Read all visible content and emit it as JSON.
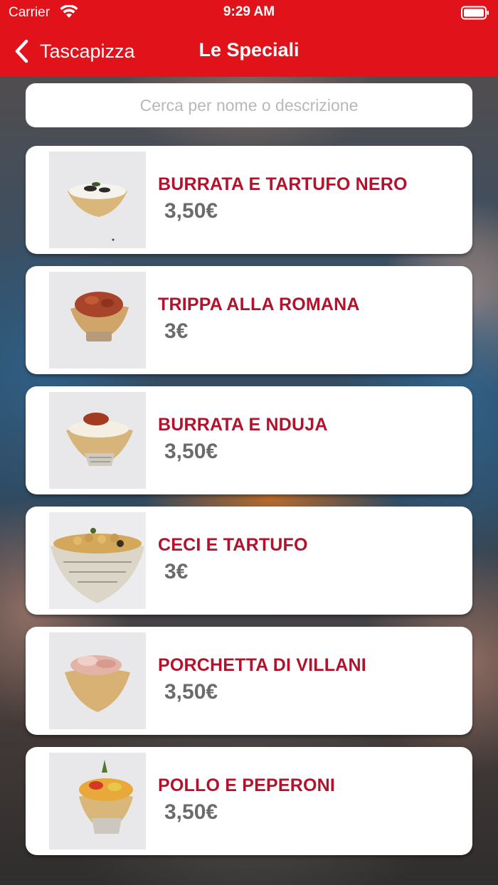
{
  "status_bar": {
    "carrier": "Carrier",
    "time": "9:29 AM"
  },
  "nav": {
    "back_label": "Tascapizza",
    "title": "Le Speciali"
  },
  "search": {
    "placeholder": "Cerca per nome o descrizione",
    "value": ""
  },
  "products": [
    {
      "name": "BURRATA E TARTUFO NERO",
      "price": "3,50€",
      "image_icon": "burrata-tartufo-photo"
    },
    {
      "name": "TRIPPA ALLA ROMANA",
      "price": "3€",
      "image_icon": "trippa-photo"
    },
    {
      "name": "BURRATA E NDUJA",
      "price": "3,50€",
      "image_icon": "burrata-nduja-photo"
    },
    {
      "name": "CECI E TARTUFO",
      "price": "3€",
      "image_icon": "ceci-tartufo-photo"
    },
    {
      "name": "PORCHETTA DI VILLANI",
      "price": "3,50€",
      "image_icon": "porchetta-photo"
    },
    {
      "name": "POLLO E PEPERONI",
      "price": "3,50€",
      "image_icon": "pollo-peperoni-photo"
    }
  ],
  "colors": {
    "nav_background": "#e2121b",
    "product_name": "#b2122b",
    "price": "#6b6b6b"
  }
}
